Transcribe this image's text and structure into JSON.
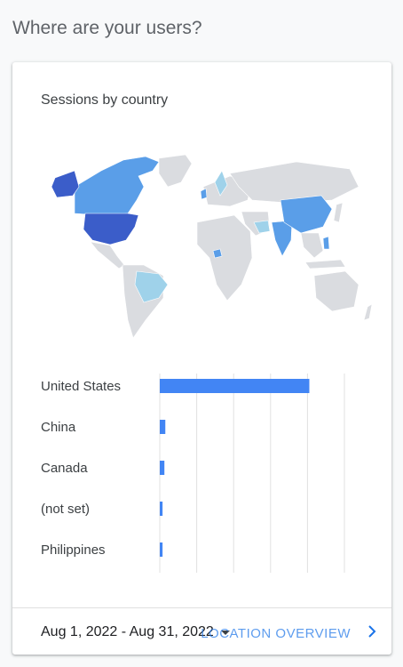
{
  "page": {
    "heading": "Where are your users?"
  },
  "card": {
    "title": "Sessions by country"
  },
  "map": {
    "colors": {
      "land": "#dadce0",
      "high": "#3b5dc9",
      "medium": "#5a9ee8",
      "low": "#9fd2ea"
    }
  },
  "chart_data": {
    "type": "bar",
    "orientation": "horizontal",
    "categories": [
      "United States",
      "China",
      "Canada",
      "(not set)",
      "Philippines"
    ],
    "values": [
      81,
      3,
      2.5,
      1.5,
      1.5
    ],
    "unit": "%",
    "xlim": [
      0,
      100
    ],
    "xticks": [
      "0%",
      "20%",
      "40%",
      "60%",
      "80%",
      "100%"
    ],
    "bar_color": "#4285f4",
    "grid": true
  },
  "footer": {
    "date_range": "Aug 1, 2022 - Aug 31, 2022",
    "link_label": "LOCATION OVERVIEW"
  }
}
